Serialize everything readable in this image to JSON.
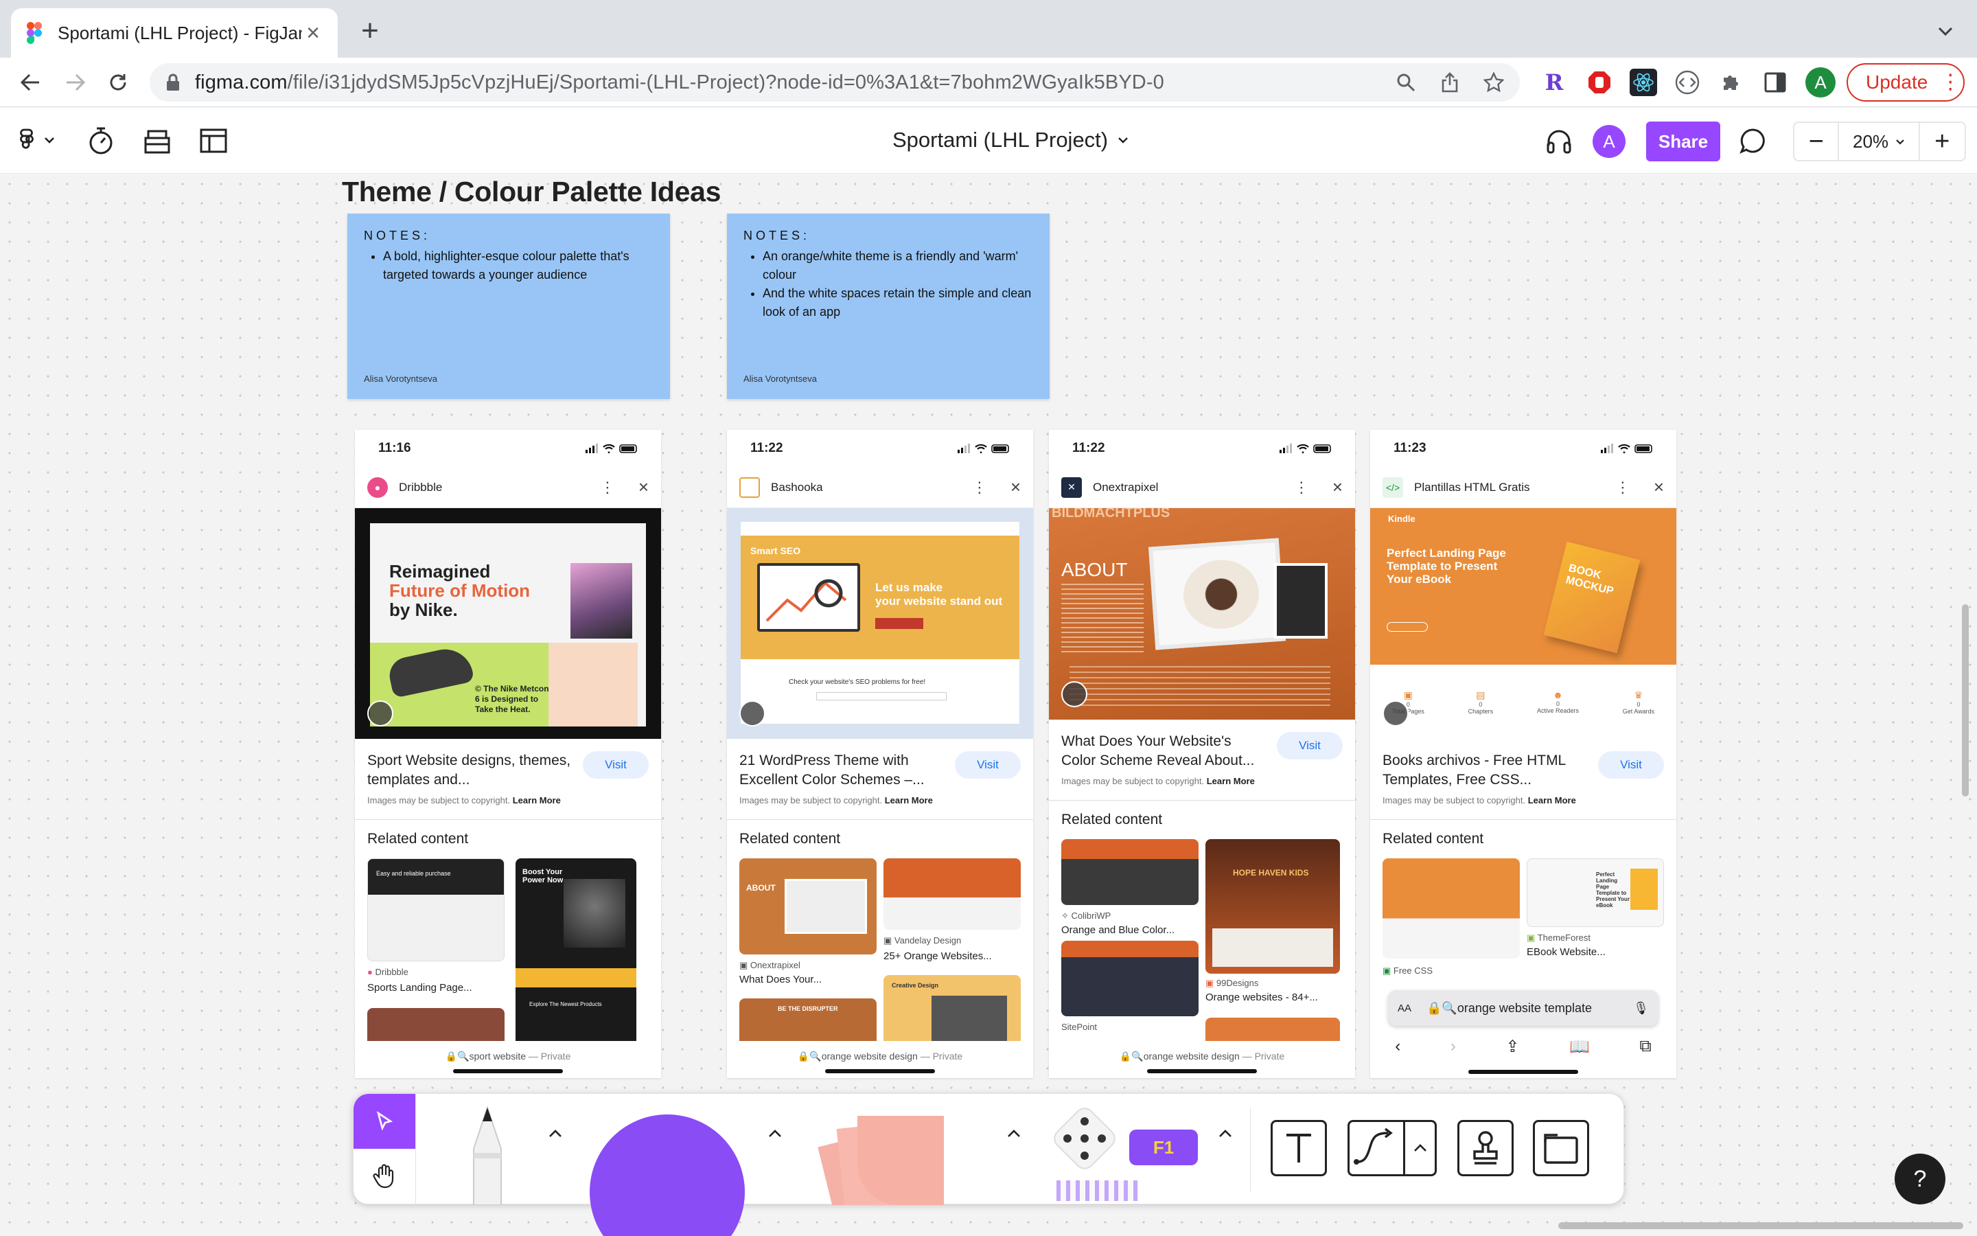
{
  "browser": {
    "tab_title": "Sportami (LHL Project) - FigJam",
    "url_domain": "figma.com",
    "url_path": "/file/i31jdydSM5Jp5cVpzjHuEj/Sportami-(LHL-Project)?node-id=0%3A1&t=7bohm2WGyaIk5BYD-0",
    "profile_initial": "A",
    "update_label": "Update"
  },
  "figma": {
    "file_title": "Sportami (LHL Project)",
    "avatar_initial": "A",
    "share_label": "Share",
    "zoom": "20%",
    "zoom_out": "−",
    "zoom_in": "+"
  },
  "canvas": {
    "section_title": "Theme / Colour Palette Ideas",
    "stickies": [
      {
        "label": "NOTES:",
        "bullets": [
          "A bold, highlighter-esque colour palette that's targeted towards a younger audience"
        ],
        "author": "Alisa Vorotyntseva"
      },
      {
        "label": "NOTES:",
        "bullets": [
          "An orange/white theme is a friendly and 'warm' colour",
          "And the white spaces retain the simple and clean look of an app"
        ],
        "author": "Alisa Vorotyntseva"
      }
    ],
    "phones": [
      {
        "time": "11:16",
        "source": "Dribbble",
        "hero_text": [
          "Reimagined",
          "Future of Motion",
          "by Nike."
        ],
        "hero_sub": "© The Nike Metcon 6 is Designed to Take the Heat.",
        "caption": "Sport Website designs, themes, templates and...",
        "visit": "Visit",
        "copyright": "Images may be subject to copyright.",
        "learn_more": "Learn More",
        "related_title": "Related content",
        "related": [
          {
            "source": "Dribbble",
            "title": "Sports Landing Page..."
          }
        ],
        "related_tile_text": [
          "Easy and reliable purchase",
          "Boost Your Power Now",
          "Explore The Newest Products"
        ],
        "search": "sport website",
        "privacy": "— Private"
      },
      {
        "time": "11:22",
        "source": "Bashooka",
        "hero_text": [
          "Smart SEO",
          "Let us make",
          "your website stand out"
        ],
        "hero_sub": "Check your website's SEO problems for free!",
        "caption": "21 WordPress Theme with Excellent Color Schemes –...",
        "visit": "Visit",
        "copyright": "Images may be subject to copyright.",
        "learn_more": "Learn More",
        "related_title": "Related content",
        "related": [
          {
            "source": "Onextrapixel",
            "title": "What Does Your..."
          },
          {
            "source": "Vandelay Design",
            "title": "25+ Orange Websites..."
          }
        ],
        "related_tile_text": [
          "ABOUT",
          "BE THE DISRUPTER",
          "Creative Design"
        ],
        "search": "orange website design",
        "privacy": "— Private"
      },
      {
        "time": "11:22",
        "source": "Onextrapixel",
        "hero_text": [
          "ABOUT"
        ],
        "hero_sub": "BILDMACHTPLUS",
        "caption": "What Does Your Website's Color Scheme Reveal About...",
        "visit": "Visit",
        "copyright": "Images may be subject to copyright.",
        "learn_more": "Learn More",
        "related_title": "Related content",
        "related": [
          {
            "source": "ColibriWP",
            "title": "Orange and Blue Color..."
          },
          {
            "source": "99Designs",
            "title": "Orange websites - 84+..."
          },
          {
            "source": "SitePoint",
            "title": ""
          }
        ],
        "related_tile_text": [
          "HOPE HAVEN KIDS"
        ],
        "search": "orange website design",
        "privacy": "— Private"
      },
      {
        "time": "11:23",
        "source": "Plantillas HTML Gratis",
        "hero_text": [
          "Kindle",
          "Perfect Landing Page Template to Present Your eBook",
          "BOOK MOCKUP"
        ],
        "hero_stats": [
          "0",
          "0",
          "0",
          "0"
        ],
        "hero_stat_labels": [
          "Total Pages",
          "Chapters",
          "Active Readers",
          "Get Awards"
        ],
        "caption": "Books archivos - Free HTML Templates, Free CSS...",
        "visit": "Visit",
        "copyright": "Images may be subject to copyright.",
        "learn_more": "Learn More",
        "related_title": "Related content",
        "related": [
          {
            "source": "Free CSS",
            "title": ""
          },
          {
            "source": "ThemeForest",
            "title": "EBook Website..."
          }
        ],
        "related_tile_text": [
          "Perfect Landing Page Template to Present Your eBook"
        ],
        "address_bar": {
          "aa": "AA",
          "query": "orange website template"
        }
      }
    ]
  },
  "dock": {
    "tools": [
      "move-tool",
      "hand-tool",
      "marker-tool",
      "shape-tool",
      "sticky-note-tool",
      "stamp-widgets-tool",
      "text-tool",
      "connector-tool",
      "stamp-tool",
      "section-tool"
    ],
    "widget_label": "F1"
  },
  "help_label": "?",
  "colors": {
    "figma_purple": "#9747ff",
    "sticky_blue": "#98c5f5",
    "update_red": "#d93025"
  }
}
